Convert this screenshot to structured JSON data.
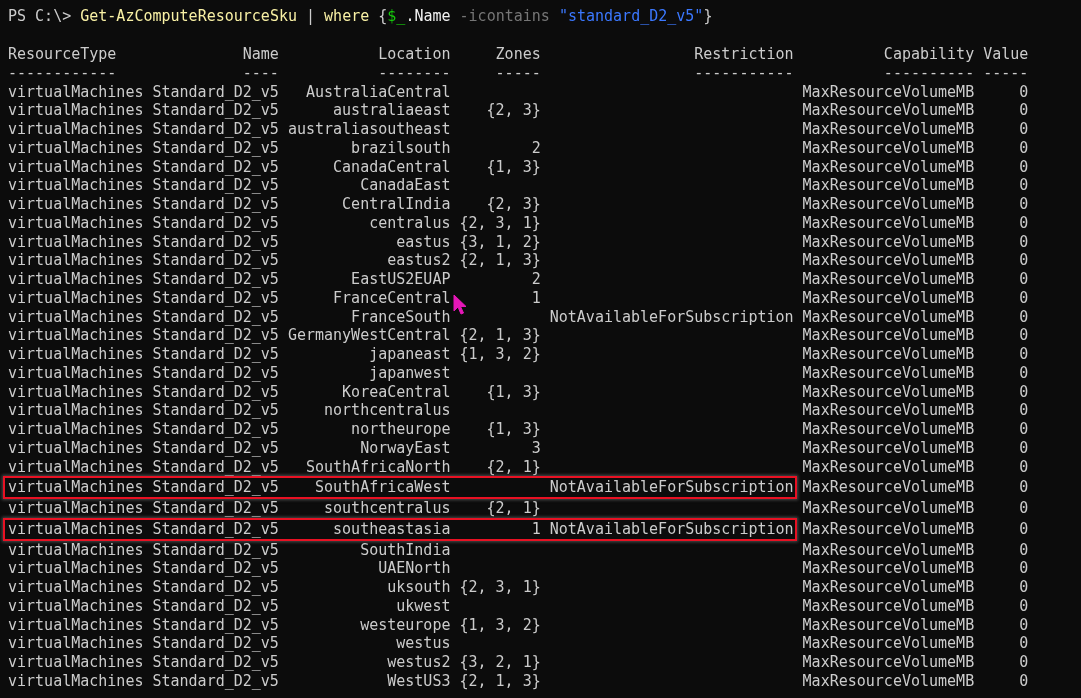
{
  "command": [
    {
      "text": "PS C:\\> ",
      "kind": "prompt"
    },
    {
      "text": "Get-AzComputeResourceSku",
      "kind": "cmdlet"
    },
    {
      "text": " | ",
      "kind": "plain"
    },
    {
      "text": "where",
      "kind": "cmdlet"
    },
    {
      "text": " {",
      "kind": "plain"
    },
    {
      "text": "$_",
      "kind": "variable"
    },
    {
      "text": ".Name",
      "kind": "member"
    },
    {
      "text": " -icontains ",
      "kind": "operator"
    },
    {
      "text": "\"standard_D2_v5\"",
      "kind": "string"
    },
    {
      "text": "}",
      "kind": "plain"
    }
  ],
  "table": {
    "columns": [
      {
        "label": "ResourceType",
        "underline": "------------"
      },
      {
        "label": "Name",
        "underline": "----"
      },
      {
        "label": "Location",
        "underline": "--------"
      },
      {
        "label": "Zones",
        "underline": "-----"
      },
      {
        "label": "Restriction",
        "underline": "-----------"
      },
      {
        "label": "Capability",
        "underline": "----------"
      },
      {
        "label": "Value",
        "underline": "-----"
      }
    ],
    "rows": [
      {
        "cells": [
          "virtualMachines",
          "Standard_D2_v5",
          "AustraliaCentral",
          null,
          null,
          "MaxResourceVolumeMB",
          "0"
        ],
        "highlighted": false
      },
      {
        "cells": [
          "virtualMachines",
          "Standard_D2_v5",
          "australiaeast",
          "{2, 3}",
          null,
          "MaxResourceVolumeMB",
          "0"
        ],
        "highlighted": false
      },
      {
        "cells": [
          "virtualMachines",
          "Standard_D2_v5",
          "australiasoutheast",
          null,
          null,
          "MaxResourceVolumeMB",
          "0"
        ],
        "highlighted": false
      },
      {
        "cells": [
          "virtualMachines",
          "Standard_D2_v5",
          "brazilsouth",
          "2",
          null,
          "MaxResourceVolumeMB",
          "0"
        ],
        "highlighted": false
      },
      {
        "cells": [
          "virtualMachines",
          "Standard_D2_v5",
          "CanadaCentral",
          "{1, 3}",
          null,
          "MaxResourceVolumeMB",
          "0"
        ],
        "highlighted": false
      },
      {
        "cells": [
          "virtualMachines",
          "Standard_D2_v5",
          "CanadaEast",
          null,
          null,
          "MaxResourceVolumeMB",
          "0"
        ],
        "highlighted": false
      },
      {
        "cells": [
          "virtualMachines",
          "Standard_D2_v5",
          "CentralIndia",
          "{2, 3}",
          null,
          "MaxResourceVolumeMB",
          "0"
        ],
        "highlighted": false
      },
      {
        "cells": [
          "virtualMachines",
          "Standard_D2_v5",
          "centralus",
          "{2, 3, 1}",
          null,
          "MaxResourceVolumeMB",
          "0"
        ],
        "highlighted": false
      },
      {
        "cells": [
          "virtualMachines",
          "Standard_D2_v5",
          "eastus",
          "{3, 1, 2}",
          null,
          "MaxResourceVolumeMB",
          "0"
        ],
        "highlighted": false
      },
      {
        "cells": [
          "virtualMachines",
          "Standard_D2_v5",
          "eastus2",
          "{2, 1, 3}",
          null,
          "MaxResourceVolumeMB",
          "0"
        ],
        "highlighted": false
      },
      {
        "cells": [
          "virtualMachines",
          "Standard_D2_v5",
          "EastUS2EUAP",
          "2",
          null,
          "MaxResourceVolumeMB",
          "0"
        ],
        "highlighted": false
      },
      {
        "cells": [
          "virtualMachines",
          "Standard_D2_v5",
          "FranceCentral",
          "1",
          null,
          "MaxResourceVolumeMB",
          "0"
        ],
        "highlighted": false
      },
      {
        "cells": [
          "virtualMachines",
          "Standard_D2_v5",
          "FranceSouth",
          null,
          "NotAvailableForSubscription",
          "MaxResourceVolumeMB",
          "0"
        ],
        "highlighted": false
      },
      {
        "cells": [
          "virtualMachines",
          "Standard_D2_v5",
          "GermanyWestCentral",
          "{2, 1, 3}",
          null,
          "MaxResourceVolumeMB",
          "0"
        ],
        "highlighted": false
      },
      {
        "cells": [
          "virtualMachines",
          "Standard_D2_v5",
          "japaneast",
          "{1, 3, 2}",
          null,
          "MaxResourceVolumeMB",
          "0"
        ],
        "highlighted": false
      },
      {
        "cells": [
          "virtualMachines",
          "Standard_D2_v5",
          "japanwest",
          null,
          null,
          "MaxResourceVolumeMB",
          "0"
        ],
        "highlighted": false
      },
      {
        "cells": [
          "virtualMachines",
          "Standard_D2_v5",
          "KoreaCentral",
          "{1, 3}",
          null,
          "MaxResourceVolumeMB",
          "0"
        ],
        "highlighted": false
      },
      {
        "cells": [
          "virtualMachines",
          "Standard_D2_v5",
          "northcentralus",
          null,
          null,
          "MaxResourceVolumeMB",
          "0"
        ],
        "highlighted": false
      },
      {
        "cells": [
          "virtualMachines",
          "Standard_D2_v5",
          "northeurope",
          "{1, 3}",
          null,
          "MaxResourceVolumeMB",
          "0"
        ],
        "highlighted": false
      },
      {
        "cells": [
          "virtualMachines",
          "Standard_D2_v5",
          "NorwayEast",
          "3",
          null,
          "MaxResourceVolumeMB",
          "0"
        ],
        "highlighted": false
      },
      {
        "cells": [
          "virtualMachines",
          "Standard_D2_v5",
          "SouthAfricaNorth",
          "{2, 1}",
          null,
          "MaxResourceVolumeMB",
          "0"
        ],
        "highlighted": false
      },
      {
        "cells": [
          "virtualMachines",
          "Standard_D2_v5",
          "SouthAfricaWest",
          null,
          "NotAvailableForSubscription",
          "MaxResourceVolumeMB",
          "0"
        ],
        "highlighted": true
      },
      {
        "cells": [
          "virtualMachines",
          "Standard_D2_v5",
          "southcentralus",
          "{2, 1}",
          null,
          "MaxResourceVolumeMB",
          "0"
        ],
        "highlighted": false
      },
      {
        "cells": [
          "virtualMachines",
          "Standard_D2_v5",
          "southeastasia",
          "1",
          "NotAvailableForSubscription",
          "MaxResourceVolumeMB",
          "0"
        ],
        "highlighted": true
      },
      {
        "cells": [
          "virtualMachines",
          "Standard_D2_v5",
          "SouthIndia",
          null,
          null,
          "MaxResourceVolumeMB",
          "0"
        ],
        "highlighted": false
      },
      {
        "cells": [
          "virtualMachines",
          "Standard_D2_v5",
          "UAENorth",
          null,
          null,
          "MaxResourceVolumeMB",
          "0"
        ],
        "highlighted": false
      },
      {
        "cells": [
          "virtualMachines",
          "Standard_D2_v5",
          "uksouth",
          "{2, 3, 1}",
          null,
          "MaxResourceVolumeMB",
          "0"
        ],
        "highlighted": false
      },
      {
        "cells": [
          "virtualMachines",
          "Standard_D2_v5",
          "ukwest",
          null,
          null,
          "MaxResourceVolumeMB",
          "0"
        ],
        "highlighted": false
      },
      {
        "cells": [
          "virtualMachines",
          "Standard_D2_v5",
          "westeurope",
          "{1, 3, 2}",
          null,
          "MaxResourceVolumeMB",
          "0"
        ],
        "highlighted": false
      },
      {
        "cells": [
          "virtualMachines",
          "Standard_D2_v5",
          "westus",
          null,
          null,
          "MaxResourceVolumeMB",
          "0"
        ],
        "highlighted": false
      },
      {
        "cells": [
          "virtualMachines",
          "Standard_D2_v5",
          "westus2",
          "{3, 2, 1}",
          null,
          "MaxResourceVolumeMB",
          "0"
        ],
        "highlighted": false
      },
      {
        "cells": [
          "virtualMachines",
          "Standard_D2_v5",
          "WestUS3",
          "{2, 1, 3}",
          null,
          "MaxResourceVolumeMB",
          "0"
        ],
        "highlighted": false
      }
    ]
  }
}
